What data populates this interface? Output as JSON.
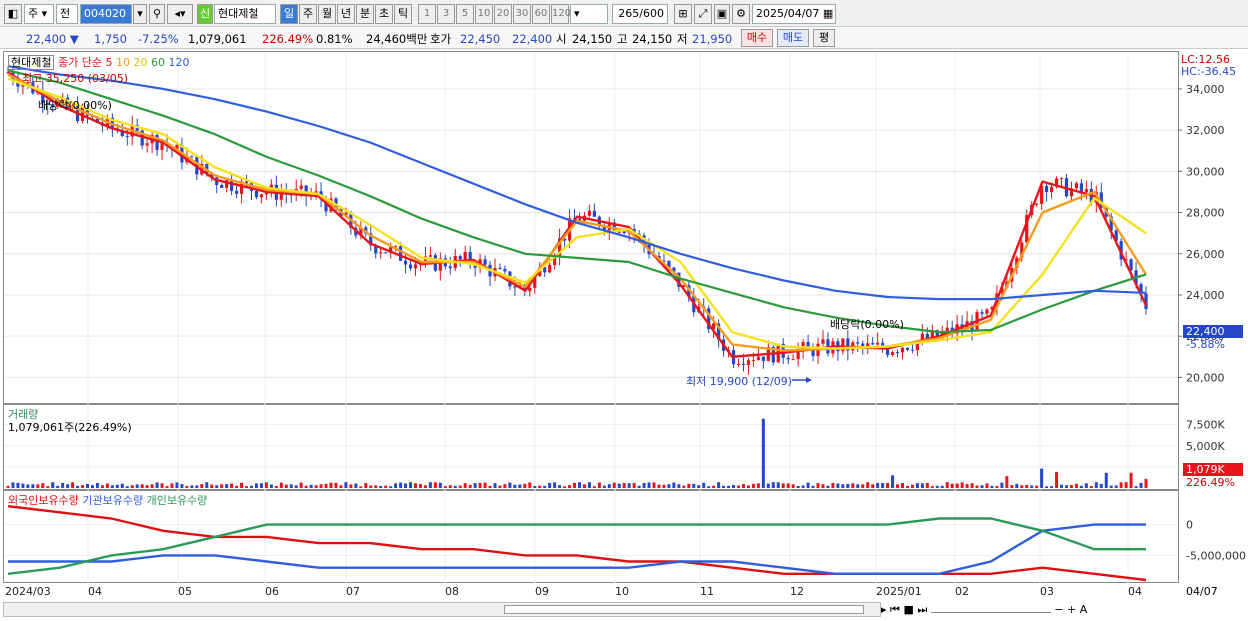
{
  "toolbar": {
    "market": "주",
    "all": "전",
    "code": "004020",
    "new_badge": "신",
    "stock_name": "현대제철",
    "periods": [
      "일",
      "주",
      "월",
      "년",
      "분",
      "초",
      "틱"
    ],
    "active_period": "일",
    "ticks": [
      "1",
      "3",
      "5",
      "10",
      "20",
      "30",
      "60",
      "120"
    ],
    "count": "265",
    "count_total": "/600",
    "date": "2025/04/07"
  },
  "quote": {
    "price": "22,400",
    "arrow": "▼",
    "change": "1,750",
    "change_pct": "-7.25%",
    "volume": "1,079,061",
    "vol_ratio": "226.49%",
    "turnover": "0.81%",
    "amount": "24,460백만",
    "bid_label": "호가",
    "bid": "22,450",
    "ask": "22,400",
    "open_label": "시",
    "open": "24,150",
    "high_label": "고",
    "high": "24,150",
    "low_label": "저",
    "low": "21,950",
    "buy": "매수",
    "sell": "매도",
    "avg": "평"
  },
  "price_panel": {
    "name": "현대제철",
    "ma_title": "종가 단순",
    "ma_periods": [
      "5",
      "10",
      "20",
      "60",
      "120"
    ],
    "high_note": "최고 35,250 (03/05)",
    "low_note": "최저 19,900 (12/09)",
    "div1": "배당락(0.00%)",
    "div2": "배당락(0.00%)",
    "lc": "LC:12.56",
    "hc": "HC:-36.45",
    "last_price": "22,400",
    "last_pct": "-5.88%"
  },
  "volume_panel": {
    "title": "거래량",
    "value": "1,079,061주(226.49%)",
    "last": "1,079K",
    "last_pct": "226.49%"
  },
  "holding_panel": {
    "legend": [
      "외국인보유수량",
      "기관보유수량",
      "개인보유수량"
    ]
  },
  "x_axis": {
    "labels": [
      "2024/03",
      "04",
      "05",
      "06",
      "07",
      "08",
      "09",
      "10",
      "11",
      "12",
      "2025/01",
      "02",
      "03",
      "04"
    ],
    "right_label": "04/07"
  },
  "colors": {
    "ma5": "#e8141c",
    "ma10": "#f59b1e",
    "ma20": "#f5e21e",
    "ma60": "#2a9a3a",
    "ma120": "#2f5fe0",
    "up": "#e8141c",
    "down": "#2546c8",
    "foreign": "#e01010",
    "inst": "#2f5fe0",
    "indiv": "#2a9a5a"
  },
  "chart_data": [
    {
      "type": "line",
      "title": "현대제철",
      "y_ticks": [
        20000,
        22000,
        24000,
        26000,
        28000,
        30000,
        32000,
        34000
      ],
      "ylim": [
        19000,
        35500
      ],
      "x_categories": [
        "2024/03",
        "04",
        "05",
        "06",
        "07",
        "08",
        "09",
        "10",
        "11",
        "12",
        "2025/01",
        "02",
        "03",
        "04"
      ],
      "series": [
        {
          "name": "5",
          "values": [
            34800,
            33200,
            32100,
            31400,
            29600,
            29000,
            28800,
            26500,
            25500,
            25700,
            24200,
            27800,
            27300,
            24500,
            21000,
            21200,
            21500,
            21400,
            22000,
            23000,
            29500,
            28800,
            23500
          ]
        },
        {
          "name": "10",
          "values": [
            34700,
            33400,
            32300,
            31500,
            29800,
            29100,
            28900,
            26900,
            25600,
            25600,
            24400,
            27600,
            27100,
            24800,
            21600,
            21300,
            21400,
            21500,
            21900,
            22800,
            28000,
            29000,
            25000
          ]
        },
        {
          "name": "20",
          "values": [
            34500,
            33600,
            32500,
            31800,
            30200,
            29200,
            28900,
            27400,
            25800,
            25500,
            24600,
            26800,
            27200,
            25600,
            22200,
            21500,
            21400,
            21500,
            21800,
            22200,
            25000,
            28700,
            27000
          ]
        },
        {
          "name": "60",
          "values": [
            34900,
            34300,
            33500,
            32700,
            31800,
            30700,
            29800,
            28800,
            27700,
            26800,
            26000,
            25800,
            25600,
            24800,
            24100,
            23400,
            22900,
            22500,
            22200,
            22300,
            23300,
            24200,
            25000
          ]
        },
        {
          "name": "120",
          "values": [
            35100,
            34700,
            34400,
            34000,
            33500,
            32900,
            32200,
            31400,
            30400,
            29400,
            28400,
            27500,
            26800,
            26000,
            25300,
            24700,
            24200,
            23900,
            23800,
            23800,
            24000,
            24200,
            24100
          ]
        }
      ]
    },
    {
      "type": "bar",
      "title": "거래량",
      "y_ticks": [
        "7,500K",
        "5,000K",
        "2,500K"
      ],
      "ylim": [
        0,
        9000
      ],
      "spikes_k": [
        8200,
        1500,
        1400,
        2300,
        1900,
        1800,
        1800
      ],
      "last_k": 1079
    },
    {
      "type": "line",
      "title": "보유수량",
      "y_ticks": [
        "0",
        "-5,000,000"
      ],
      "series": [
        {
          "name": "외국인보유수량",
          "values": [
            3,
            2,
            1,
            -1,
            -2,
            -2,
            -3,
            -3,
            -4,
            -4,
            -5,
            -5,
            -6,
            -6,
            -7,
            -8,
            -8,
            -8,
            -8,
            -8,
            -7,
            -8,
            -9
          ]
        },
        {
          "name": "기관보유수량",
          "values": [
            -6,
            -6,
            -6,
            -5,
            -5,
            -6,
            -7,
            -7,
            -7,
            -7,
            -7,
            -7,
            -7,
            -6,
            -6,
            -7,
            -8,
            -8,
            -8,
            -6,
            -1,
            0,
            0
          ]
        },
        {
          "name": "개인보유수량",
          "values": [
            -8,
            -7,
            -5,
            -4,
            -2,
            0,
            0,
            0,
            0,
            0,
            0,
            0,
            0,
            0,
            0,
            0,
            0,
            0,
            1,
            1,
            -1,
            -4,
            -4
          ]
        }
      ]
    }
  ]
}
